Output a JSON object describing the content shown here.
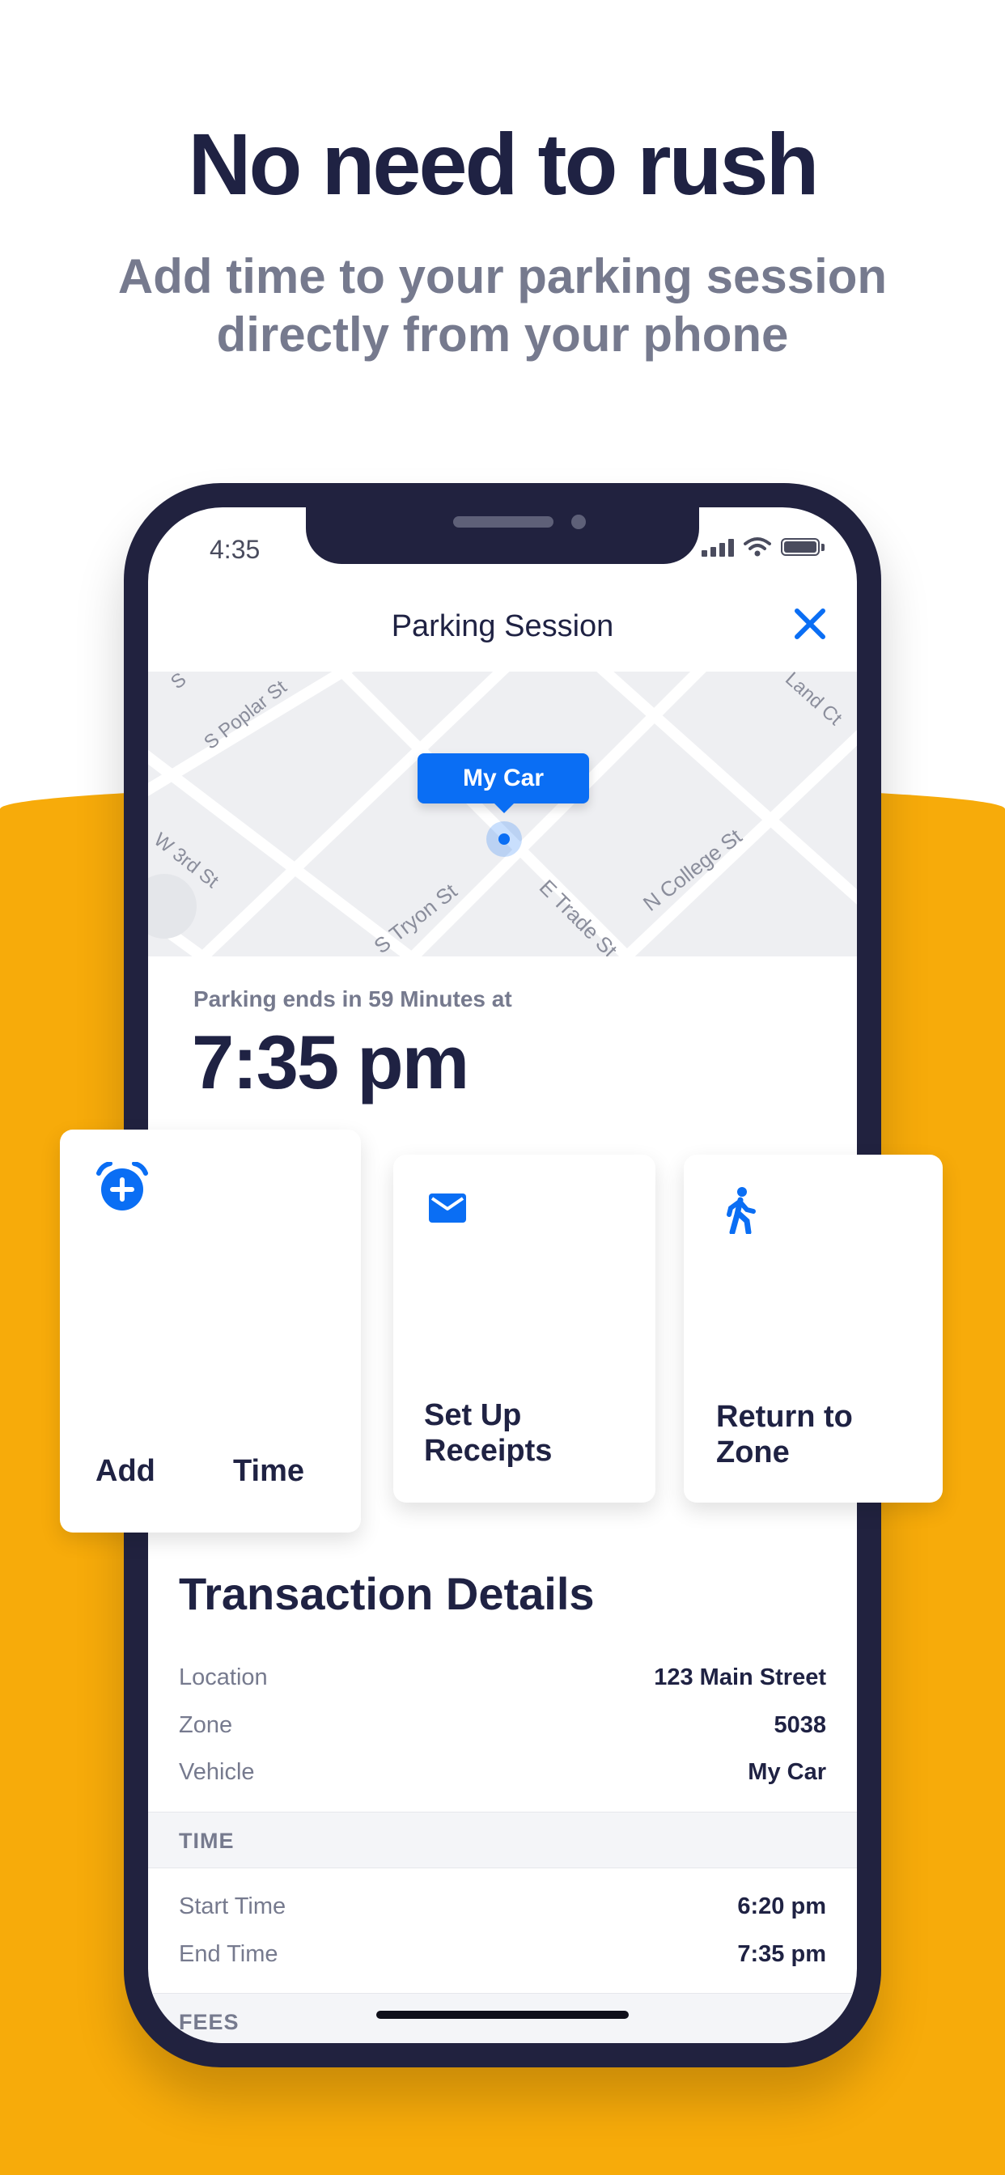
{
  "promo": {
    "headline": "No need to rush",
    "subhead": "Add time to your parking session directly from your phone"
  },
  "status_bar": {
    "time": "4:35"
  },
  "nav": {
    "title": "Parking Session",
    "close_icon": "close-icon"
  },
  "map": {
    "marker_label": "My Car",
    "streets": [
      "S Poplar St",
      "W 3rd St",
      "S Tryon St",
      "E Trade St",
      "N College St",
      "Land Ct",
      "S"
    ]
  },
  "session": {
    "ends_label": "Parking ends in 59 Minutes at",
    "ends_time": "7:35 pm"
  },
  "actions": [
    {
      "word1": "Add",
      "word2": "Time",
      "icon": "alarm-add-icon"
    },
    {
      "line1": "Set Up",
      "line2": "Receipts",
      "icon": "envelope-icon"
    },
    {
      "line1": "Return to",
      "line2": "Zone",
      "icon": "walking-person-icon"
    }
  ],
  "transaction": {
    "title": "Transaction Details",
    "rows": [
      {
        "key": "Location",
        "value": "123 Main Street"
      },
      {
        "key": "Zone",
        "value": "5038"
      },
      {
        "key": "Vehicle",
        "value": "My Car"
      }
    ],
    "time_section": "TIME",
    "time_rows": [
      {
        "key": "Start Time",
        "value": "6:20 pm"
      },
      {
        "key": "End Time",
        "value": "7:35 pm"
      }
    ],
    "fees_section": "FEES"
  },
  "colors": {
    "accent": "#0a6ef4",
    "navy": "#1f2243",
    "orange": "#f7ab0a",
    "gray_text": "#767a8e"
  }
}
